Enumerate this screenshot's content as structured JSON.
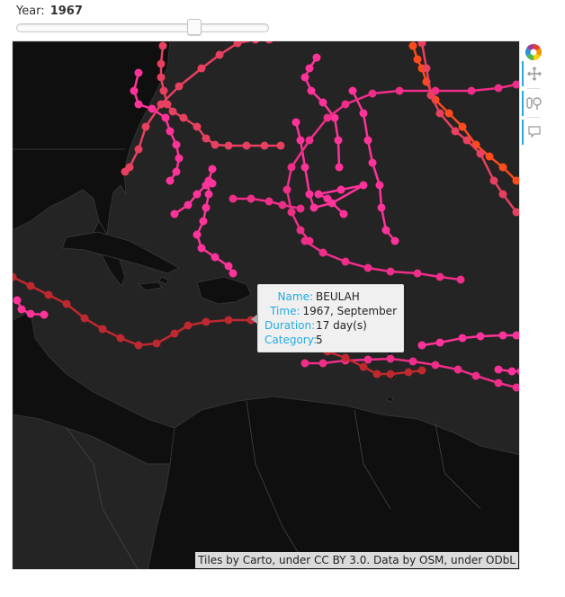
{
  "slider": {
    "title": "Year:",
    "value": "1967",
    "min": 1851,
    "max": 2015,
    "current": 1967
  },
  "tooltip": {
    "rows": [
      {
        "key": "Name:",
        "value": "BEULAH"
      },
      {
        "key": "Time:",
        "value": "1967, September"
      },
      {
        "key": "Duration:",
        "value": "17 day(s)"
      },
      {
        "key": "Category:",
        "value": "5"
      }
    ]
  },
  "attribution": "Tiles by Carto, under CC BY 3.0. Data by OSM, under ODbL",
  "toolbar": {
    "tools": [
      {
        "name": "bokeh-logo-icon",
        "active": false
      },
      {
        "name": "pan-tool-icon",
        "active": true
      },
      {
        "name": "wheel-zoom-tool-icon",
        "active": true
      },
      {
        "name": "hover-tool-icon",
        "active": true
      }
    ]
  },
  "colors": {
    "land": "#0f0f0f",
    "water": "#242424",
    "track_pink": "#ff3399",
    "track_magenta": "#ee2e88",
    "track_red": "#c0282f",
    "track_orange": "#ff4a1c",
    "track_rose": "#e84060",
    "accent": "#26aae1"
  }
}
